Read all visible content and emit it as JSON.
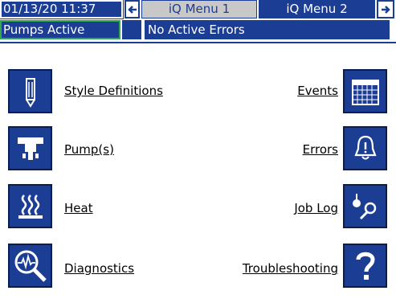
{
  "header": {
    "datetime": "01/13/20 11:37",
    "prev_arrow": "←",
    "next_arrow": "→",
    "tabs": [
      {
        "label": "iQ Menu 1",
        "active": true
      },
      {
        "label": "iQ Menu 2",
        "active": false
      }
    ]
  },
  "status": {
    "pumps": "Pumps Active",
    "errors": "No Active Errors"
  },
  "menu": {
    "left": [
      {
        "label": "Style Definitions",
        "icon": "pencil-icon"
      },
      {
        "label": "Pump(s)",
        "icon": "pump-icon"
      },
      {
        "label": "Heat",
        "icon": "heat-icon"
      },
      {
        "label": "Diagnostics",
        "icon": "diagnostics-magnifier-icon"
      }
    ],
    "right": [
      {
        "label": "Events",
        "icon": "calendar-grid-icon"
      },
      {
        "label": "Errors",
        "icon": "alarm-bell-icon"
      },
      {
        "label": "Job Log",
        "icon": "job-log-icon"
      },
      {
        "label": "Troubleshooting",
        "icon": "question-mark-icon"
      }
    ]
  },
  "colors": {
    "primary": "#1c3d94",
    "active_outline": "#2fa84f",
    "tab_active_bg": "#c8c8c8"
  }
}
